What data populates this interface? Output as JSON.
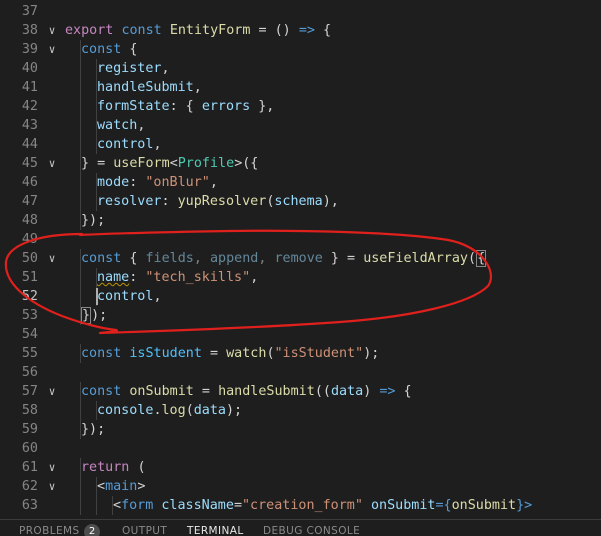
{
  "editor": {
    "current_line": 52,
    "lines": [
      {
        "n": "37",
        "indent": 0,
        "tokens": []
      },
      {
        "n": "38",
        "indent": 0,
        "fold": "chevron-down",
        "tokens": [
          {
            "t": "export ",
            "c": "ctrl"
          },
          {
            "t": "const ",
            "c": "kw"
          },
          {
            "t": "EntityForm",
            "c": "fn"
          },
          {
            "t": " = () ",
            "c": "punc"
          },
          {
            "t": "=>",
            "c": "kw"
          },
          {
            "t": " {",
            "c": "punc"
          }
        ]
      },
      {
        "n": "39",
        "indent": 1,
        "fold": "chevron-down",
        "tokens": [
          {
            "t": "const ",
            "c": "kw"
          },
          {
            "t": "{",
            "c": "punc"
          }
        ]
      },
      {
        "n": "40",
        "indent": 2,
        "tokens": [
          {
            "t": "register",
            "c": "var"
          },
          {
            "t": ",",
            "c": "punc"
          }
        ]
      },
      {
        "n": "41",
        "indent": 2,
        "tokens": [
          {
            "t": "handleSubmit",
            "c": "var"
          },
          {
            "t": ",",
            "c": "punc"
          }
        ]
      },
      {
        "n": "42",
        "indent": 2,
        "tokens": [
          {
            "t": "formState",
            "c": "var"
          },
          {
            "t": ": { ",
            "c": "punc"
          },
          {
            "t": "errors",
            "c": "var"
          },
          {
            "t": " },",
            "c": "punc"
          }
        ]
      },
      {
        "n": "43",
        "indent": 2,
        "tokens": [
          {
            "t": "watch",
            "c": "var"
          },
          {
            "t": ",",
            "c": "punc"
          }
        ]
      },
      {
        "n": "44",
        "indent": 2,
        "tokens": [
          {
            "t": "control",
            "c": "var"
          },
          {
            "t": ",",
            "c": "punc"
          }
        ]
      },
      {
        "n": "45",
        "indent": 1,
        "fold": "chevron-down",
        "tokens": [
          {
            "t": "} = ",
            "c": "punc"
          },
          {
            "t": "useForm",
            "c": "fn"
          },
          {
            "t": "<",
            "c": "punc"
          },
          {
            "t": "Profile",
            "c": "type"
          },
          {
            "t": ">({",
            "c": "punc"
          }
        ]
      },
      {
        "n": "46",
        "indent": 2,
        "tokens": [
          {
            "t": "mode",
            "c": "var"
          },
          {
            "t": ": ",
            "c": "punc"
          },
          {
            "t": "\"onBlur\"",
            "c": "str"
          },
          {
            "t": ",",
            "c": "punc"
          }
        ]
      },
      {
        "n": "47",
        "indent": 2,
        "tokens": [
          {
            "t": "resolver",
            "c": "var"
          },
          {
            "t": ": ",
            "c": "punc"
          },
          {
            "t": "yupResolver",
            "c": "fn"
          },
          {
            "t": "(",
            "c": "punc"
          },
          {
            "t": "schema",
            "c": "var"
          },
          {
            "t": "),",
            "c": "punc"
          }
        ]
      },
      {
        "n": "48",
        "indent": 1,
        "tokens": [
          {
            "t": "});",
            "c": "punc"
          }
        ]
      },
      {
        "n": "49",
        "indent": 0,
        "tokens": []
      },
      {
        "n": "50",
        "indent": 1,
        "fold": "chevron-down",
        "tokens": [
          {
            "t": "const ",
            "c": "kw"
          },
          {
            "t": "{ ",
            "c": "punc"
          },
          {
            "t": "fields",
            "c": "var",
            "dim": true
          },
          {
            "t": ", ",
            "c": "punc",
            "dim": true
          },
          {
            "t": "append",
            "c": "var",
            "dim": true
          },
          {
            "t": ", ",
            "c": "punc",
            "dim": true
          },
          {
            "t": "remove",
            "c": "var",
            "dim": true
          },
          {
            "t": " } = ",
            "c": "punc"
          },
          {
            "t": "useFieldArray",
            "c": "fn"
          },
          {
            "t": "(",
            "c": "punc"
          },
          {
            "t": "{",
            "c": "punc",
            "bracket": true
          }
        ]
      },
      {
        "n": "51",
        "indent": 2,
        "tokens": [
          {
            "t": "name",
            "c": "var",
            "wavy": true
          },
          {
            "t": ": ",
            "c": "punc"
          },
          {
            "t": "\"tech_skills\"",
            "c": "str"
          },
          {
            "t": ",",
            "c": "punc"
          }
        ]
      },
      {
        "n": "52",
        "indent": 2,
        "tokens": [
          {
            "t": "control",
            "c": "var"
          },
          {
            "t": ",",
            "c": "punc"
          }
        ]
      },
      {
        "n": "53",
        "indent": 1,
        "tokens": [
          {
            "t": "}",
            "c": "punc",
            "bracket": true
          },
          {
            "t": ");",
            "c": "punc"
          }
        ]
      },
      {
        "n": "54",
        "indent": 0,
        "tokens": []
      },
      {
        "n": "55",
        "indent": 1,
        "tokens": [
          {
            "t": "const ",
            "c": "kw"
          },
          {
            "t": "isStudent",
            "c": "const"
          },
          {
            "t": " = ",
            "c": "punc"
          },
          {
            "t": "watch",
            "c": "fn"
          },
          {
            "t": "(",
            "c": "punc"
          },
          {
            "t": "\"isStudent\"",
            "c": "str"
          },
          {
            "t": ");",
            "c": "punc"
          }
        ]
      },
      {
        "n": "56",
        "indent": 0,
        "tokens": []
      },
      {
        "n": "57",
        "indent": 1,
        "fold": "chevron-down",
        "tokens": [
          {
            "t": "const ",
            "c": "kw"
          },
          {
            "t": "onSubmit",
            "c": "fn"
          },
          {
            "t": " = ",
            "c": "punc"
          },
          {
            "t": "handleSubmit",
            "c": "fn"
          },
          {
            "t": "((",
            "c": "punc"
          },
          {
            "t": "data",
            "c": "var"
          },
          {
            "t": ") ",
            "c": "punc"
          },
          {
            "t": "=>",
            "c": "kw"
          },
          {
            "t": " {",
            "c": "punc"
          }
        ]
      },
      {
        "n": "58",
        "indent": 2,
        "tokens": [
          {
            "t": "console",
            "c": "var"
          },
          {
            "t": ".",
            "c": "punc"
          },
          {
            "t": "log",
            "c": "fn"
          },
          {
            "t": "(",
            "c": "punc"
          },
          {
            "t": "data",
            "c": "var"
          },
          {
            "t": ");",
            "c": "punc"
          }
        ]
      },
      {
        "n": "59",
        "indent": 1,
        "tokens": [
          {
            "t": "});",
            "c": "punc"
          }
        ]
      },
      {
        "n": "60",
        "indent": 0,
        "tokens": []
      },
      {
        "n": "61",
        "indent": 1,
        "fold": "chevron-down",
        "tokens": [
          {
            "t": "return ",
            "c": "ctrl"
          },
          {
            "t": "(",
            "c": "punc"
          }
        ]
      },
      {
        "n": "62",
        "indent": 2,
        "fold": "chevron-down",
        "tokens": [
          {
            "t": "<",
            "c": "punc"
          },
          {
            "t": "main",
            "c": "kw"
          },
          {
            "t": ">",
            "c": "punc"
          }
        ]
      },
      {
        "n": "63",
        "indent": 3,
        "tokens": [
          {
            "t": "<",
            "c": "punc"
          },
          {
            "t": "form",
            "c": "kw"
          },
          {
            "t": " ",
            "c": "punc"
          },
          {
            "t": "className",
            "c": "var"
          },
          {
            "t": "=",
            "c": "punc"
          },
          {
            "t": "\"creation_form\"",
            "c": "str"
          },
          {
            "t": " ",
            "c": "punc"
          },
          {
            "t": "onSubmit",
            "c": "var"
          },
          {
            "t": "={",
            "c": "kw"
          },
          {
            "t": "onSubmit",
            "c": "fn"
          },
          {
            "t": "}>",
            "c": "kw"
          }
        ]
      }
    ]
  },
  "panel": {
    "tabs": [
      {
        "label": "PROBLEMS",
        "active": false
      },
      {
        "label": "OUTPUT",
        "active": false
      },
      {
        "label": "TERMINAL",
        "active": true
      },
      {
        "label": "DEBUG CONSOLE",
        "active": false
      }
    ],
    "problems_count": "2"
  },
  "annotation": {
    "shape": "hand-drawn-ellipse",
    "color": "#e0201c"
  },
  "colors": {
    "background": "#1e1e1e",
    "keyword": "#569cd6",
    "control": "#c586c0",
    "variable": "#9cdcfe",
    "constant": "#4fc1ff",
    "function": "#dcdcaa",
    "string": "#ce9178",
    "type": "#4ec9b0",
    "line_number": "#858585"
  },
  "icons": [
    "chevron-down-icon"
  ]
}
